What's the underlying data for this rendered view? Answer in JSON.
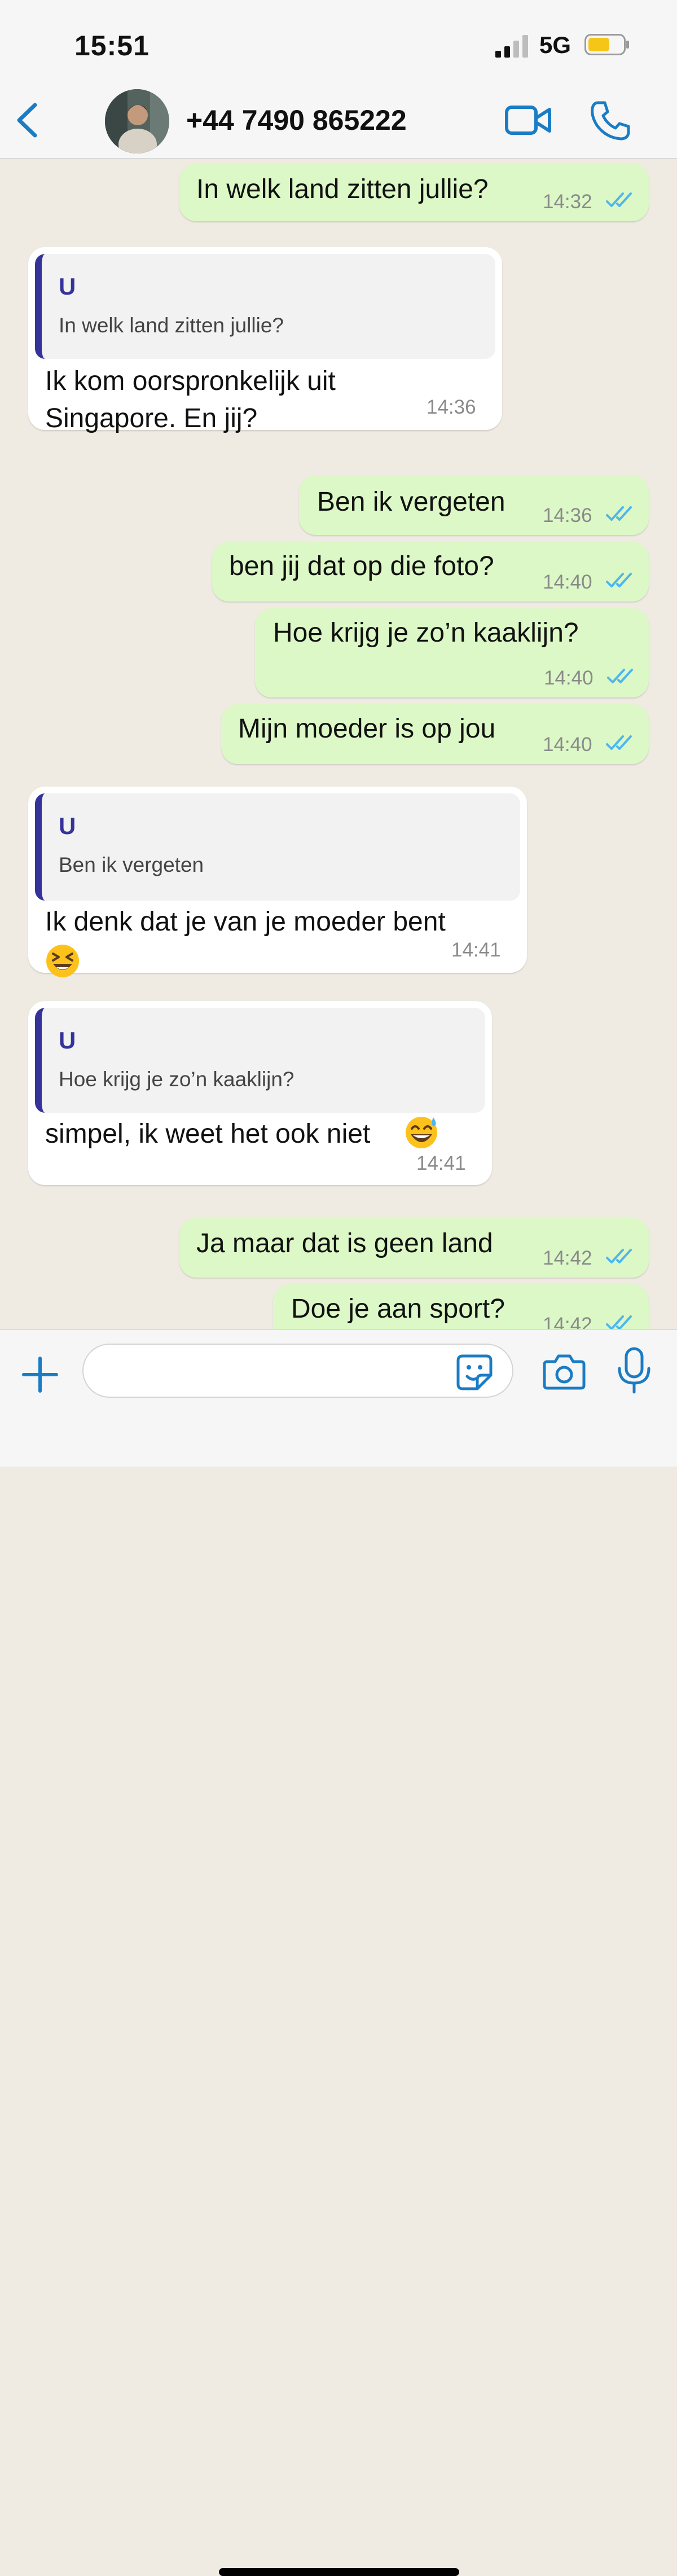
{
  "status_bar": {
    "time": "15:51",
    "network": "5G"
  },
  "header": {
    "contact_name": "+44 7490 865222"
  },
  "messages": [
    {
      "type": "sent",
      "text": "In welk land zitten jullie?",
      "time": "14:32"
    },
    {
      "type": "received",
      "quote_author": "U",
      "quote_text": "In welk land zitten jullie?",
      "text_line1": "Ik kom oorspronkelijk uit",
      "text_line2": "Singapore. En jij?",
      "time": "14:36"
    },
    {
      "type": "sent",
      "text": "Ben ik vergeten",
      "time": "14:36"
    },
    {
      "type": "sent",
      "text": "ben jij dat op die foto?",
      "time": "14:40"
    },
    {
      "type": "sent",
      "text": "Hoe krijg je zo’n kaaklijn?",
      "time": "14:40"
    },
    {
      "type": "sent",
      "text": "Mijn moeder is op jou",
      "time": "14:40"
    },
    {
      "type": "received",
      "quote_author": "U",
      "quote_text": "Ben ik vergeten",
      "text": "Ik denk dat je van je moeder bent",
      "emoji": "laughing-squinting-face",
      "time": "14:41"
    },
    {
      "type": "received",
      "quote_author": "U",
      "quote_text": "Hoe krijg je zo’n kaaklijn?",
      "text": "simpel, ik weet het ook niet",
      "emoji": "grinning-face-with-sweat",
      "time": "14:41"
    },
    {
      "type": "sent",
      "text": "Ja maar dat is geen land",
      "time": "14:42"
    },
    {
      "type": "sent",
      "text": "Doe je aan sport?",
      "time": "14:42"
    }
  ],
  "colors": {
    "sent_bubble": "#dcf8c6",
    "received_bubble": "#ffffff",
    "accent": "#1a7cc4",
    "quote_bar": "#35339a",
    "read_ticks": "#4fb6ec",
    "chat_background": "#efeae2"
  },
  "icons": [
    "back-chevron-icon",
    "video-call-icon",
    "phone-icon",
    "double-check-icon",
    "chevron-down-icon",
    "plus-icon",
    "sticker-icon",
    "camera-icon",
    "microphone-icon"
  ]
}
